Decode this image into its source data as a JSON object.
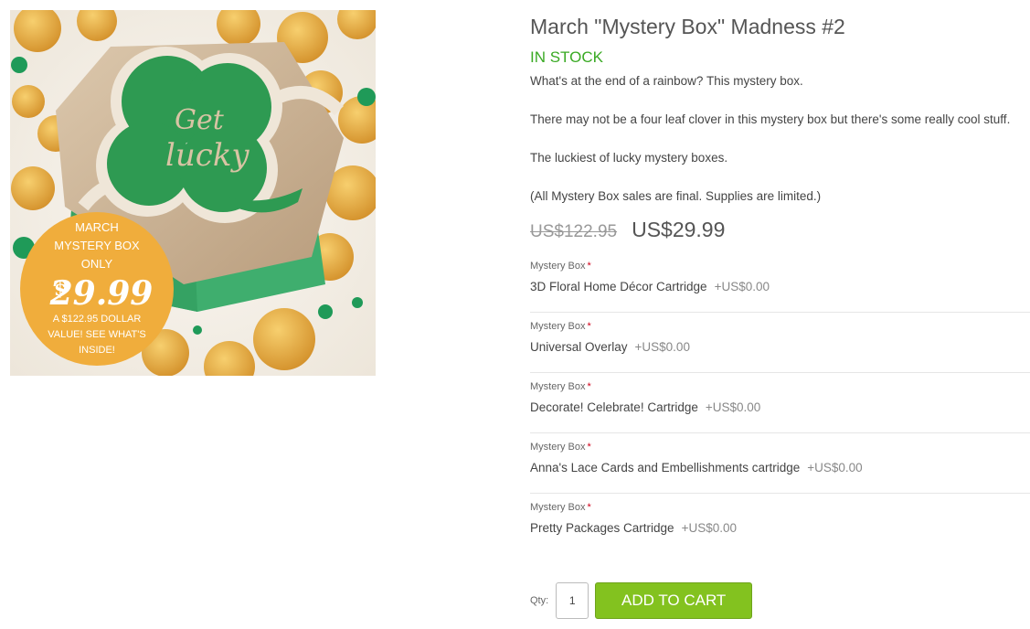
{
  "product": {
    "title": "March \"Mystery Box\" Madness #2",
    "stock_status": "IN STOCK",
    "description": [
      "What's at the end of a rainbow? This mystery box.",
      "There may not be a four leaf clover in this mystery box but there's some really cool stuff.",
      "The luckiest of lucky mystery boxes.",
      "(All Mystery Box sales are final. Supplies are limited.)"
    ],
    "old_price": "US$122.95",
    "price": "US$29.99"
  },
  "image": {
    "badge_lines": [
      "MARCH",
      "MYSTERY BOX",
      "ONLY"
    ],
    "badge_currency": "$",
    "badge_price": "29.99",
    "badge_footer": [
      "A $122.95 DOLLAR",
      "VALUE! SEE WHAT'S",
      "INSIDE!"
    ],
    "clover_text_1": "Get",
    "clover_text_2": "lucky",
    "colors": {
      "clover": "#2e9a52",
      "box_glitter": "#cdb79a",
      "box_side": "#3fae6e",
      "coin": "#e8a93a",
      "badge": "#f0ad3c"
    }
  },
  "options": [
    {
      "label": "Mystery Box",
      "required": "*",
      "value": "3D Floral Home Décor Cartridge",
      "price": "+US$0.00"
    },
    {
      "label": "Mystery Box",
      "required": "*",
      "value": "Universal Overlay",
      "price": "+US$0.00"
    },
    {
      "label": "Mystery Box",
      "required": "*",
      "value": "Decorate! Celebrate! Cartridge",
      "price": "+US$0.00"
    },
    {
      "label": "Mystery Box",
      "required": "*",
      "value": "Anna's Lace Cards and Embellishments cartridge",
      "price": "+US$0.00"
    },
    {
      "label": "Mystery Box",
      "required": "*",
      "value": "Pretty Packages Cartridge",
      "price": "+US$0.00"
    }
  ],
  "cart": {
    "qty_label": "Qty:",
    "qty_value": "1",
    "add_to_cart_label": "ADD TO CART"
  }
}
